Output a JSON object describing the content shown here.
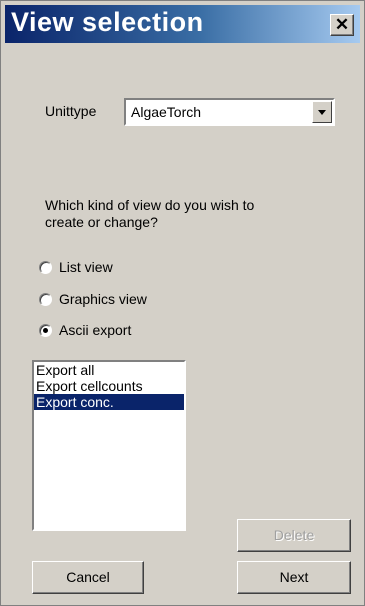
{
  "window": {
    "title": "View selection",
    "close_icon": "close-x-icon"
  },
  "unittype": {
    "label": "Unittype",
    "selected": "AlgaeTorch"
  },
  "question": {
    "line1": "Which kind of view do you wish to",
    "line2": "create or change?"
  },
  "view_types": [
    {
      "label": "List view",
      "checked": false
    },
    {
      "label": "Graphics view",
      "checked": false
    },
    {
      "label": "Ascii export",
      "checked": true
    }
  ],
  "list": {
    "items": [
      "Export all",
      "Export cellcounts",
      "Export conc."
    ],
    "selected_index": 2
  },
  "buttons": {
    "delete": "Delete",
    "cancel": "Cancel",
    "next": "Next"
  }
}
